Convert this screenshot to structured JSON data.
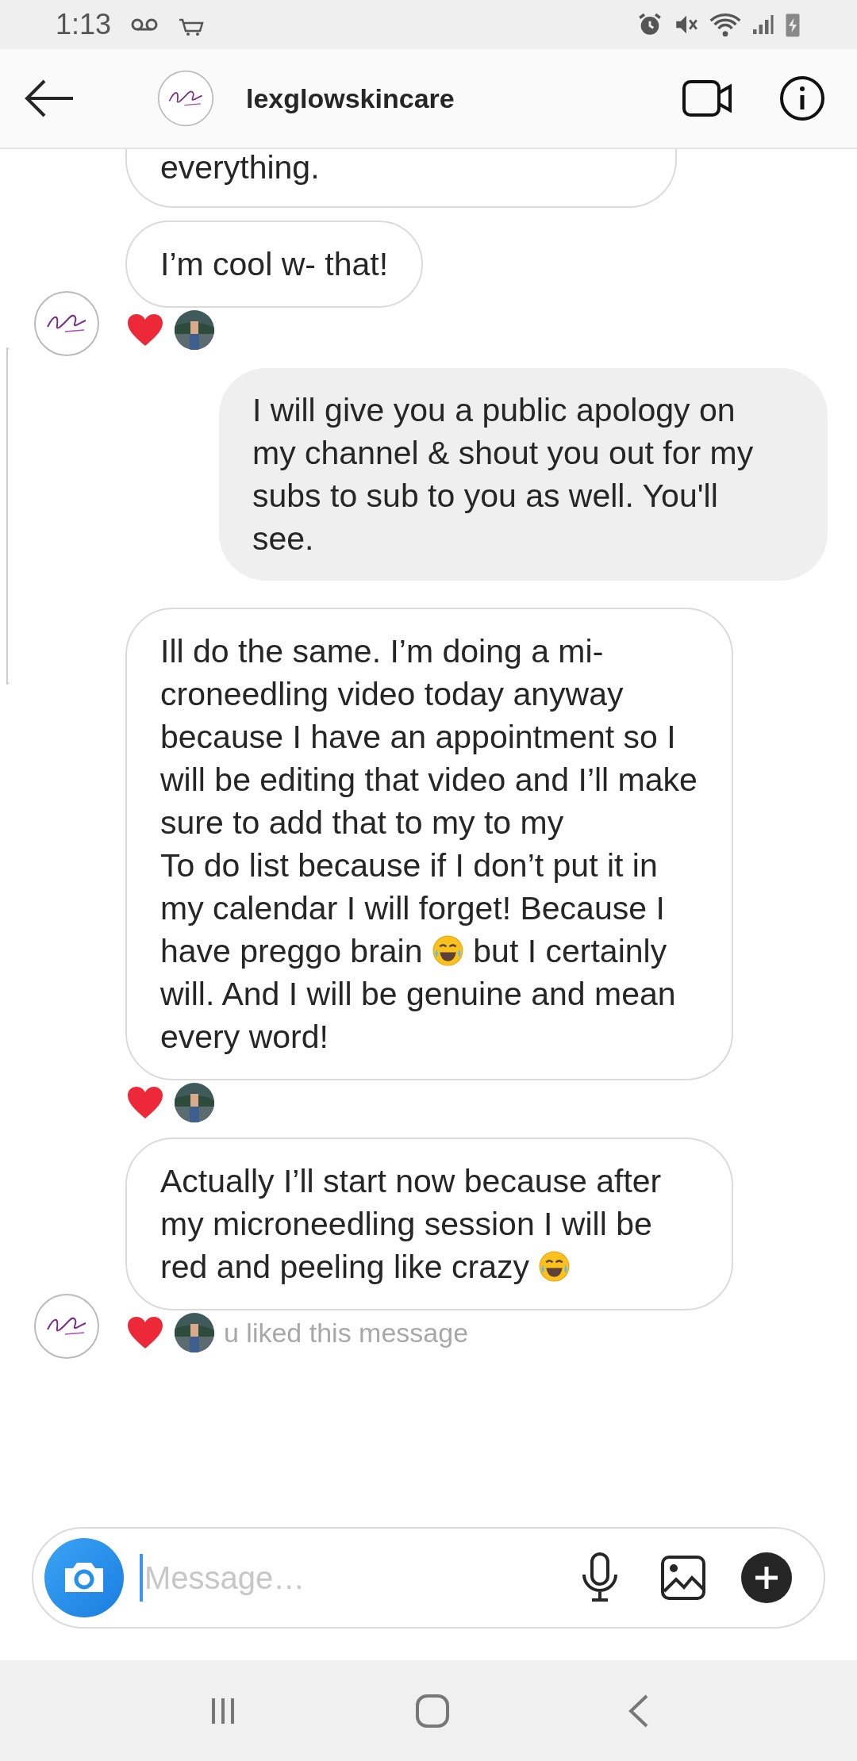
{
  "status_bar": {
    "time": "1:13"
  },
  "header": {
    "username": "lexglowskincare"
  },
  "messages": [
    {
      "kind": "received",
      "show_avatar": false,
      "reacted": false,
      "clipped": true,
      "segments": [
        {
          "kind": "text",
          "text": "everything."
        }
      ]
    },
    {
      "kind": "received",
      "show_avatar": true,
      "reacted": true,
      "clipped": false,
      "segments": [
        {
          "kind": "text",
          "text": "I’m cool w- that!"
        }
      ]
    },
    {
      "kind": "sent",
      "segments": [
        {
          "kind": "text",
          "text": "I will give you a public apology on my channel & shout you out for my subs to sub to you as well. You'll see."
        }
      ]
    },
    {
      "kind": "received",
      "show_avatar": false,
      "reacted": true,
      "clipped": false,
      "segments": [
        {
          "kind": "text",
          "text": "Ill do the same. I’m doing a mi-croneedling video today anyway because I have an appointment so I will be editing that video and I’ll make sure to add that to my to my\nTo do list because if I don’t put it in my calendar I will forget! Because I have preggo brain "
        },
        {
          "kind": "emoji"
        },
        {
          "kind": "text",
          "text": " but I certainly will. And I will be genuine and mean every word!"
        }
      ]
    },
    {
      "kind": "received",
      "show_avatar": true,
      "reacted": true,
      "clipped": false,
      "caption": "u liked this message",
      "segments": [
        {
          "kind": "text",
          "text": "Actually I’ll start now because after my microneedling session I will be red and peeling like crazy "
        },
        {
          "kind": "emoji"
        }
      ]
    }
  ],
  "composer": {
    "placeholder": "Message…"
  }
}
